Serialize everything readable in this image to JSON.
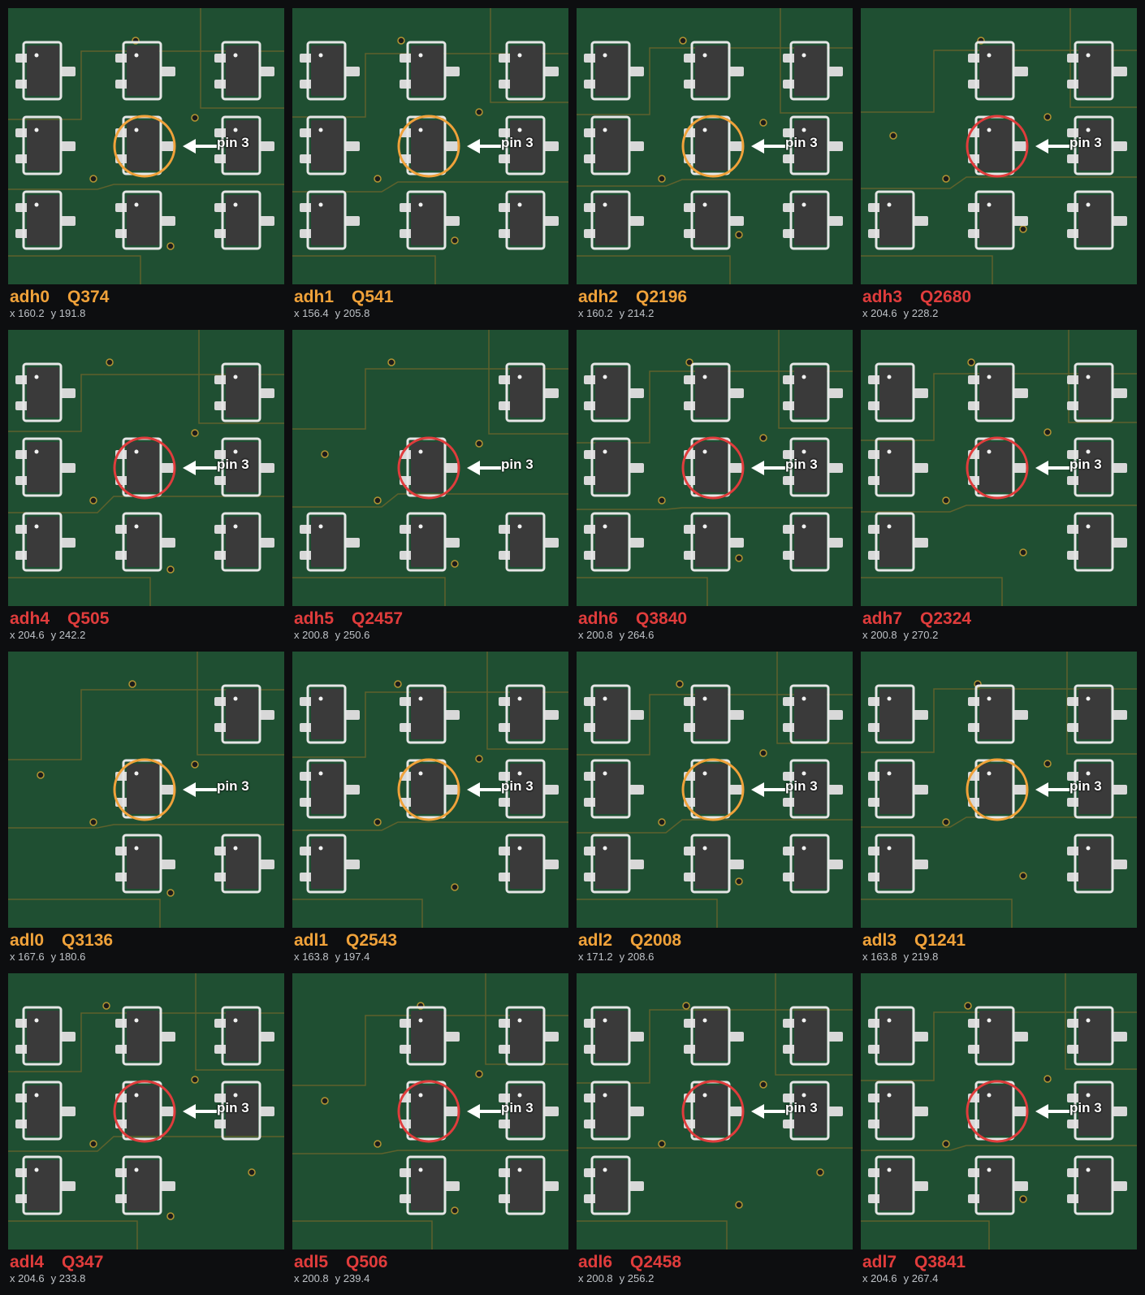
{
  "colors": {
    "background": "#0d0e10",
    "board": "#1f4f32",
    "ok": "#f0a23a",
    "fail": "#e03c3c",
    "coords": "#bfc3c8"
  },
  "icons": {
    "marker": "circle-marker-icon",
    "arrow": "left-arrow-icon",
    "chip": "sot23-transistor-icon"
  },
  "pin_label": "pin 3",
  "panels": [
    {
      "net": "adh0",
      "ref": "Q374",
      "x": "x 160.2",
      "y": "y 191.8",
      "status": "ok"
    },
    {
      "net": "adh1",
      "ref": "Q541",
      "x": "x 156.4",
      "y": "y 205.8",
      "status": "ok"
    },
    {
      "net": "adh2",
      "ref": "Q2196",
      "x": "x 160.2",
      "y": "y 214.2",
      "status": "ok"
    },
    {
      "net": "adh3",
      "ref": "Q2680",
      "x": "x 204.6",
      "y": "y 228.2",
      "status": "fail"
    },
    {
      "net": "adh4",
      "ref": "Q505",
      "x": "x 204.6",
      "y": "y 242.2",
      "status": "fail"
    },
    {
      "net": "adh5",
      "ref": "Q2457",
      "x": "x 200.8",
      "y": "y 250.6",
      "status": "fail"
    },
    {
      "net": "adh6",
      "ref": "Q3840",
      "x": "x 200.8",
      "y": "y 264.6",
      "status": "fail"
    },
    {
      "net": "adh7",
      "ref": "Q2324",
      "x": "x 200.8",
      "y": "y 270.2",
      "status": "fail"
    },
    {
      "net": "adl0",
      "ref": "Q3136",
      "x": "x 167.6",
      "y": "y 180.6",
      "status": "ok"
    },
    {
      "net": "adl1",
      "ref": "Q2543",
      "x": "x 163.8",
      "y": "y 197.4",
      "status": "ok"
    },
    {
      "net": "adl2",
      "ref": "Q2008",
      "x": "x 171.2",
      "y": "y 208.6",
      "status": "ok"
    },
    {
      "net": "adl3",
      "ref": "Q1241",
      "x": "x 163.8",
      "y": "y 219.8",
      "status": "ok"
    },
    {
      "net": "adl4",
      "ref": "Q347",
      "x": "x 204.6",
      "y": "y 233.8",
      "status": "fail"
    },
    {
      "net": "adl5",
      "ref": "Q506",
      "x": "x 200.8",
      "y": "y 239.4",
      "status": "fail"
    },
    {
      "net": "adl6",
      "ref": "Q2458",
      "x": "x 200.8",
      "y": "y 256.2",
      "status": "fail"
    },
    {
      "net": "adl7",
      "ref": "Q3841",
      "x": "x 204.6",
      "y": "y 267.4",
      "status": "fail"
    }
  ]
}
